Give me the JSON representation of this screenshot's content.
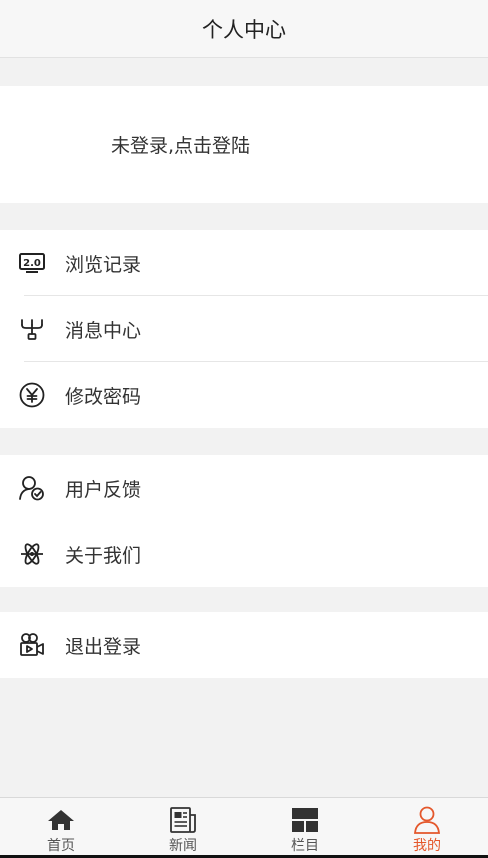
{
  "header": {
    "title": "个人中心"
  },
  "login": {
    "text": "未登录,点击登陆"
  },
  "groups": [
    {
      "items": [
        {
          "label": "浏览记录",
          "icon": "history-2.0-icon"
        },
        {
          "label": "消息中心",
          "icon": "network-icon"
        },
        {
          "label": "修改密码",
          "icon": "yen-coin-icon"
        }
      ]
    },
    {
      "items": [
        {
          "label": "用户反馈",
          "icon": "user-check-icon"
        },
        {
          "label": "关于我们",
          "icon": "atom-icon"
        }
      ]
    },
    {
      "items": [
        {
          "label": "退出登录",
          "icon": "video-camera-icon"
        }
      ]
    }
  ],
  "tabbar": {
    "tabs": [
      {
        "label": "首页",
        "icon": "home-icon",
        "active": false
      },
      {
        "label": "新闻",
        "icon": "newspaper-icon",
        "active": false
      },
      {
        "label": "栏目",
        "icon": "grid-icon",
        "active": false
      },
      {
        "label": "我的",
        "icon": "user-icon",
        "active": true
      }
    ]
  },
  "colors": {
    "accent": "#e4572b",
    "background": "#f2f2f2",
    "card": "#ffffff"
  },
  "icon_text": {
    "history_badge": "2.0"
  }
}
